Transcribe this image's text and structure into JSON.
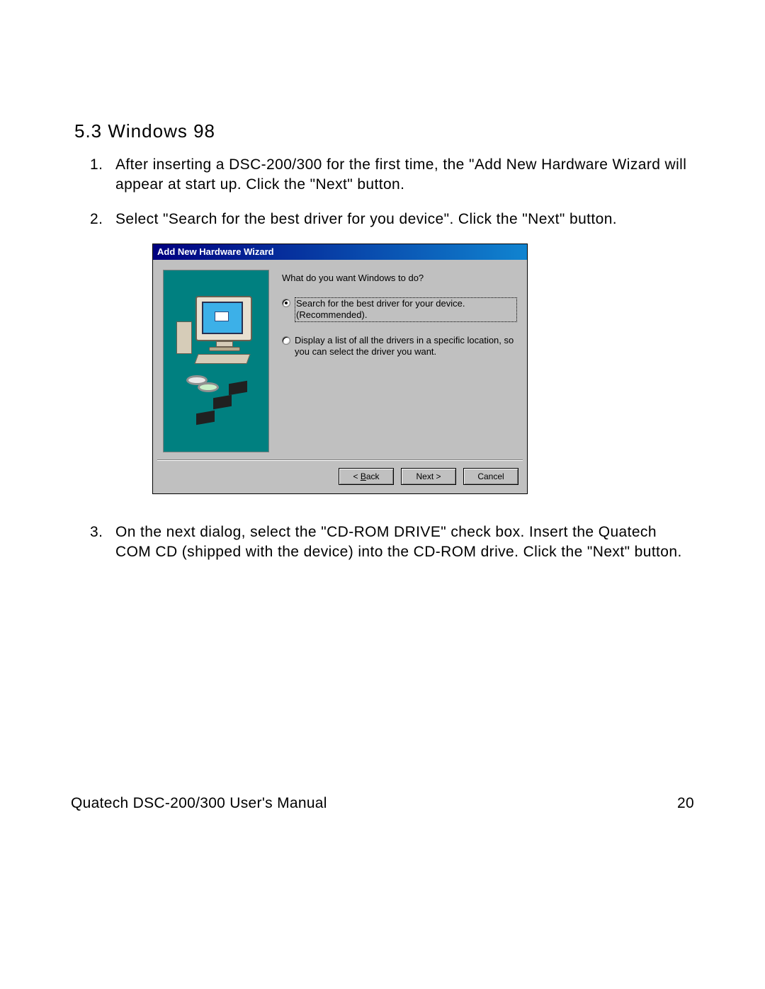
{
  "section": {
    "heading": "5.3  Windows 98"
  },
  "steps": [
    {
      "num": "1.",
      "text": "After inserting a DSC-200/300 for the first time, the \"Add New Hardware Wizard will appear at start up. Click the \"Next\" button."
    },
    {
      "num": "2.",
      "text": "Select \"Search for the best driver for you device\". Click the \"Next\" button."
    },
    {
      "num": "3.",
      "text": "On the next dialog, select the \"CD-ROM DRIVE\" check box. Insert the Quatech COM CD (shipped with the device) into the CD-ROM drive. Click the \"Next\" button."
    }
  ],
  "dialog": {
    "title": "Add New Hardware Wizard",
    "prompt": "What do you want Windows to do?",
    "options": [
      {
        "label": "Search for the best driver for your device. (Recommended).",
        "selected": true
      },
      {
        "label": "Display a list of all the drivers in a specific location, so you can select the driver you want.",
        "selected": false
      }
    ],
    "buttons": {
      "back": "< Back",
      "next": "Next >",
      "cancel": "Cancel"
    }
  },
  "footer": {
    "left": "Quatech   DSC-200/300 User's Manual",
    "right": "20"
  }
}
